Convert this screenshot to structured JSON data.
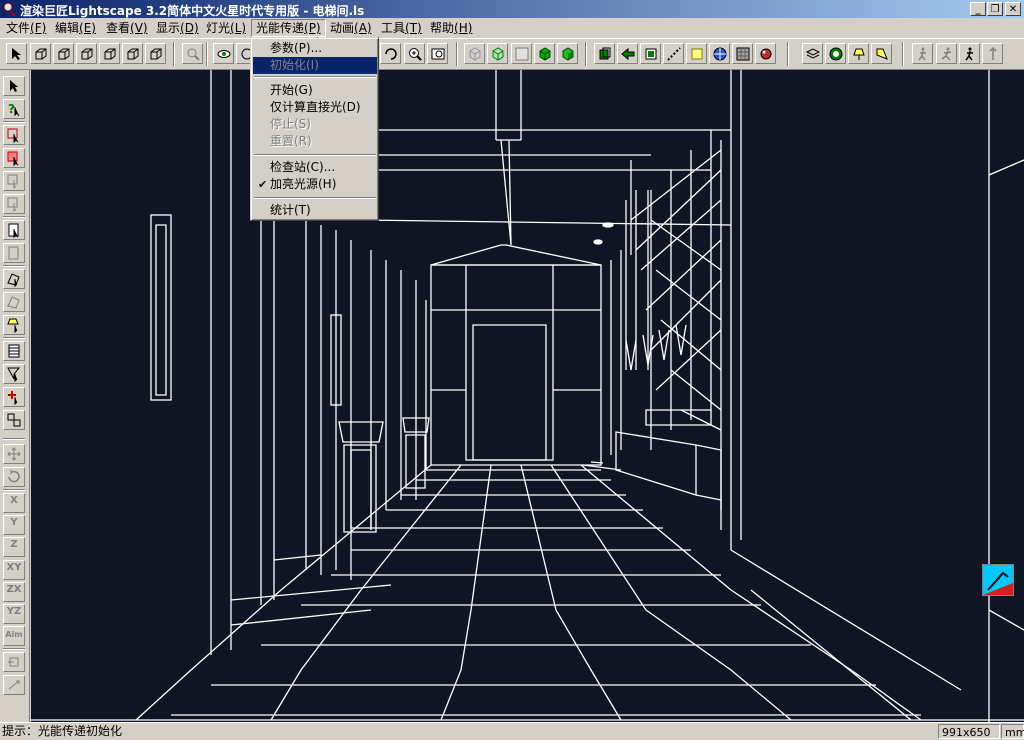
{
  "window": {
    "title": "渲染巨匠Lightscape 3.2简体中文火星时代专用版 - 电梯间.ls",
    "minimize_label": "_",
    "restore_label": "❐",
    "close_label": "✕"
  },
  "menubar": {
    "items": [
      {
        "label": "文件",
        "key": "(F)"
      },
      {
        "label": "编辑",
        "key": "(E)"
      },
      {
        "label": "查看",
        "key": "(V)"
      },
      {
        "label": "显示",
        "key": "(D)"
      },
      {
        "label": "灯光",
        "key": "(L)"
      },
      {
        "label": "光能传递",
        "key": "(P)"
      },
      {
        "label": "动画",
        "key": "(A)"
      },
      {
        "label": "工具",
        "key": "(T)"
      },
      {
        "label": "帮助",
        "key": "(H)"
      }
    ],
    "open_menu": "光能传递"
  },
  "dropdown": {
    "items": [
      {
        "label": "参数(P)...",
        "state": "enabled"
      },
      {
        "label": "初始化(I)",
        "state": "disabled-selected"
      },
      {
        "label": "开始(G)",
        "state": "enabled"
      },
      {
        "label": "仅计算直接光(D)",
        "state": "enabled"
      },
      {
        "label": "停止(S)",
        "state": "disabled"
      },
      {
        "label": "重置(R)",
        "state": "disabled"
      },
      {
        "label": "检查站(C)...",
        "state": "enabled"
      },
      {
        "label": "加亮光源(H)",
        "state": "checked"
      },
      {
        "label": "统计(T)",
        "state": "enabled"
      }
    ],
    "check_glyph": "✔"
  },
  "left_toolbar": {
    "axis_labels": [
      "X",
      "Y",
      "Z",
      "XY",
      "ZX",
      "YZ",
      "Aim"
    ]
  },
  "statusbar": {
    "hint": "提示：光能传递初始化",
    "resolution": "991x650",
    "units": "mm"
  },
  "colors": {
    "titlebar_start": "#0a246a",
    "titlebar_end": "#a6caf0",
    "viewport_bg": "#0f1522",
    "wireframe": "#ffffff",
    "menu_highlight": "#0a246a"
  }
}
